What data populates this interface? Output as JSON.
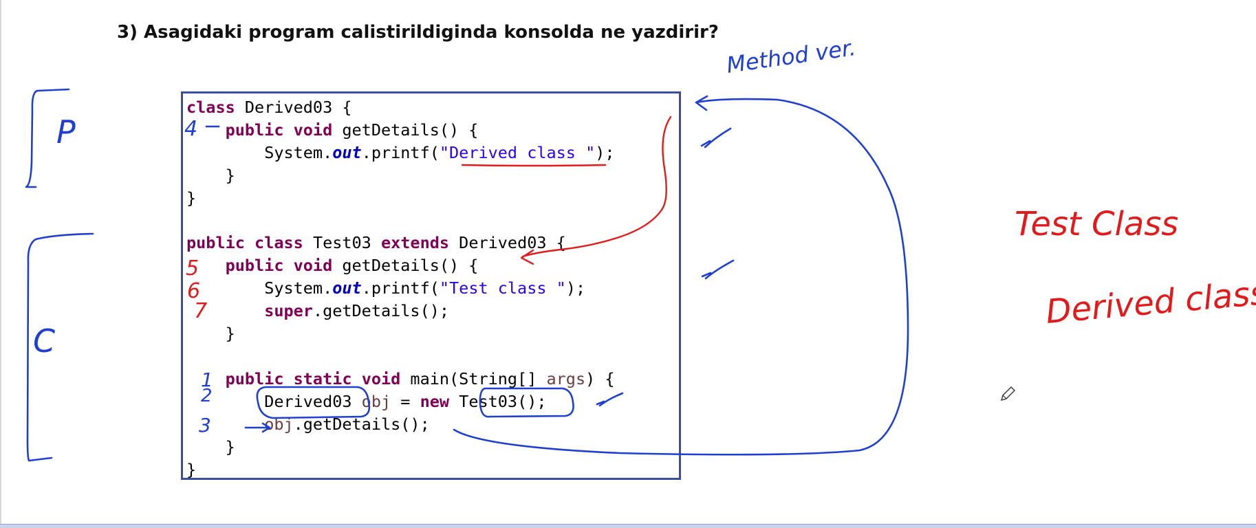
{
  "question": {
    "text": "3) Asagidaki program calistirildiginda konsolda ne yazdirir?"
  },
  "code": {
    "line1": {
      "kw": "class",
      "rest": " Derived03 {"
    },
    "line2": {
      "kw1": "public",
      "kw2": "void",
      "rest": " getDetails() {"
    },
    "line3": {
      "a": "System.",
      "field": "out",
      "b": ".printf(",
      "str": "\"Derived class \"",
      "c": ");"
    },
    "line4": {
      "text": "}"
    },
    "line5": {
      "text": "}"
    },
    "line7": {
      "kw1": "public",
      "kw2": "class",
      "mid": " Test03 ",
      "kw3": "extends",
      "rest": " Derived03 {"
    },
    "line8": {
      "kw1": "public",
      "kw2": "void",
      "rest": " getDetails() {"
    },
    "line9": {
      "a": "System.",
      "field": "out",
      "b": ".printf(",
      "str": "\"Test class \"",
      "c": ");"
    },
    "line10": {
      "kw": "super",
      "rest": ".getDetails();"
    },
    "line11": {
      "text": "}"
    },
    "line13": {
      "kw1": "public",
      "kw2": "static",
      "kw3": "void",
      "a": " main(String[] ",
      "var": "args",
      "b": ") {"
    },
    "line14": {
      "a": "Derived03 ",
      "var": "obj",
      "b": " = ",
      "kw": "new",
      "c": " Test03();"
    },
    "line15": {
      "var": "obj",
      "rest": ".getDetails();"
    },
    "line16": {
      "text": "}"
    },
    "line17": {
      "text": "}"
    }
  },
  "annotations": {
    "method_note": "Method ver.",
    "letter_p": "P",
    "letter_c": "C",
    "num_1": "1",
    "num_2": "2",
    "num_3": "3",
    "num_4": "4",
    "num_5": "5",
    "num_6": "6",
    "num_7": "7",
    "output_line1": "Test Class",
    "output_line2": "Derived class"
  },
  "colors": {
    "ink_blue": "#1f3fd0",
    "ink_red": "#e11b1b",
    "border": "#3a4f9c",
    "keyword": "#7f0055",
    "string": "#2a00ff"
  }
}
